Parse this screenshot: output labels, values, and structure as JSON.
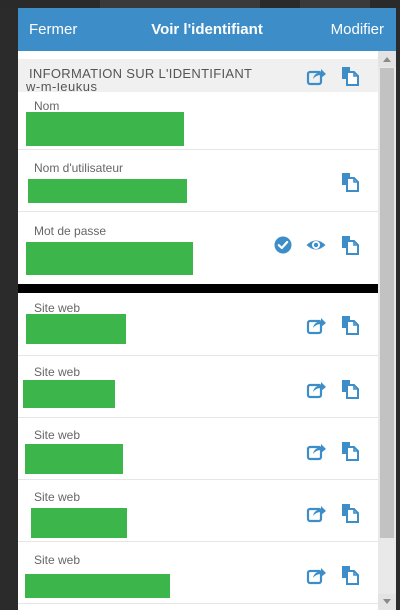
{
  "header": {
    "close_label": "Fermer",
    "title": "Voir l'identifiant",
    "edit_label": "Modifier"
  },
  "section": {
    "title": "INFORMATION SUR L'IDENTIFIANT",
    "overflow_text": "w-m-leukus"
  },
  "fields": {
    "name": {
      "label": "Nom",
      "value": ""
    },
    "username": {
      "label": "Nom d'utilisateur",
      "value": ""
    },
    "password": {
      "label": "Mot de passe",
      "value": ""
    }
  },
  "websites": [
    {
      "label": "Site web",
      "value": ""
    },
    {
      "label": "Site web",
      "value": ""
    },
    {
      "label": "Site web",
      "value": ""
    },
    {
      "label": "Site web",
      "value": ""
    },
    {
      "label": "Site web",
      "value": ""
    }
  ],
  "icons": {
    "launch": "launch-icon",
    "copy": "copy-icon",
    "check": "check-circle-icon",
    "reveal": "eye-icon"
  },
  "colors": {
    "header": "#3d8ec8",
    "icon": "#3d8ec8",
    "redaction": "#3cb54a"
  }
}
